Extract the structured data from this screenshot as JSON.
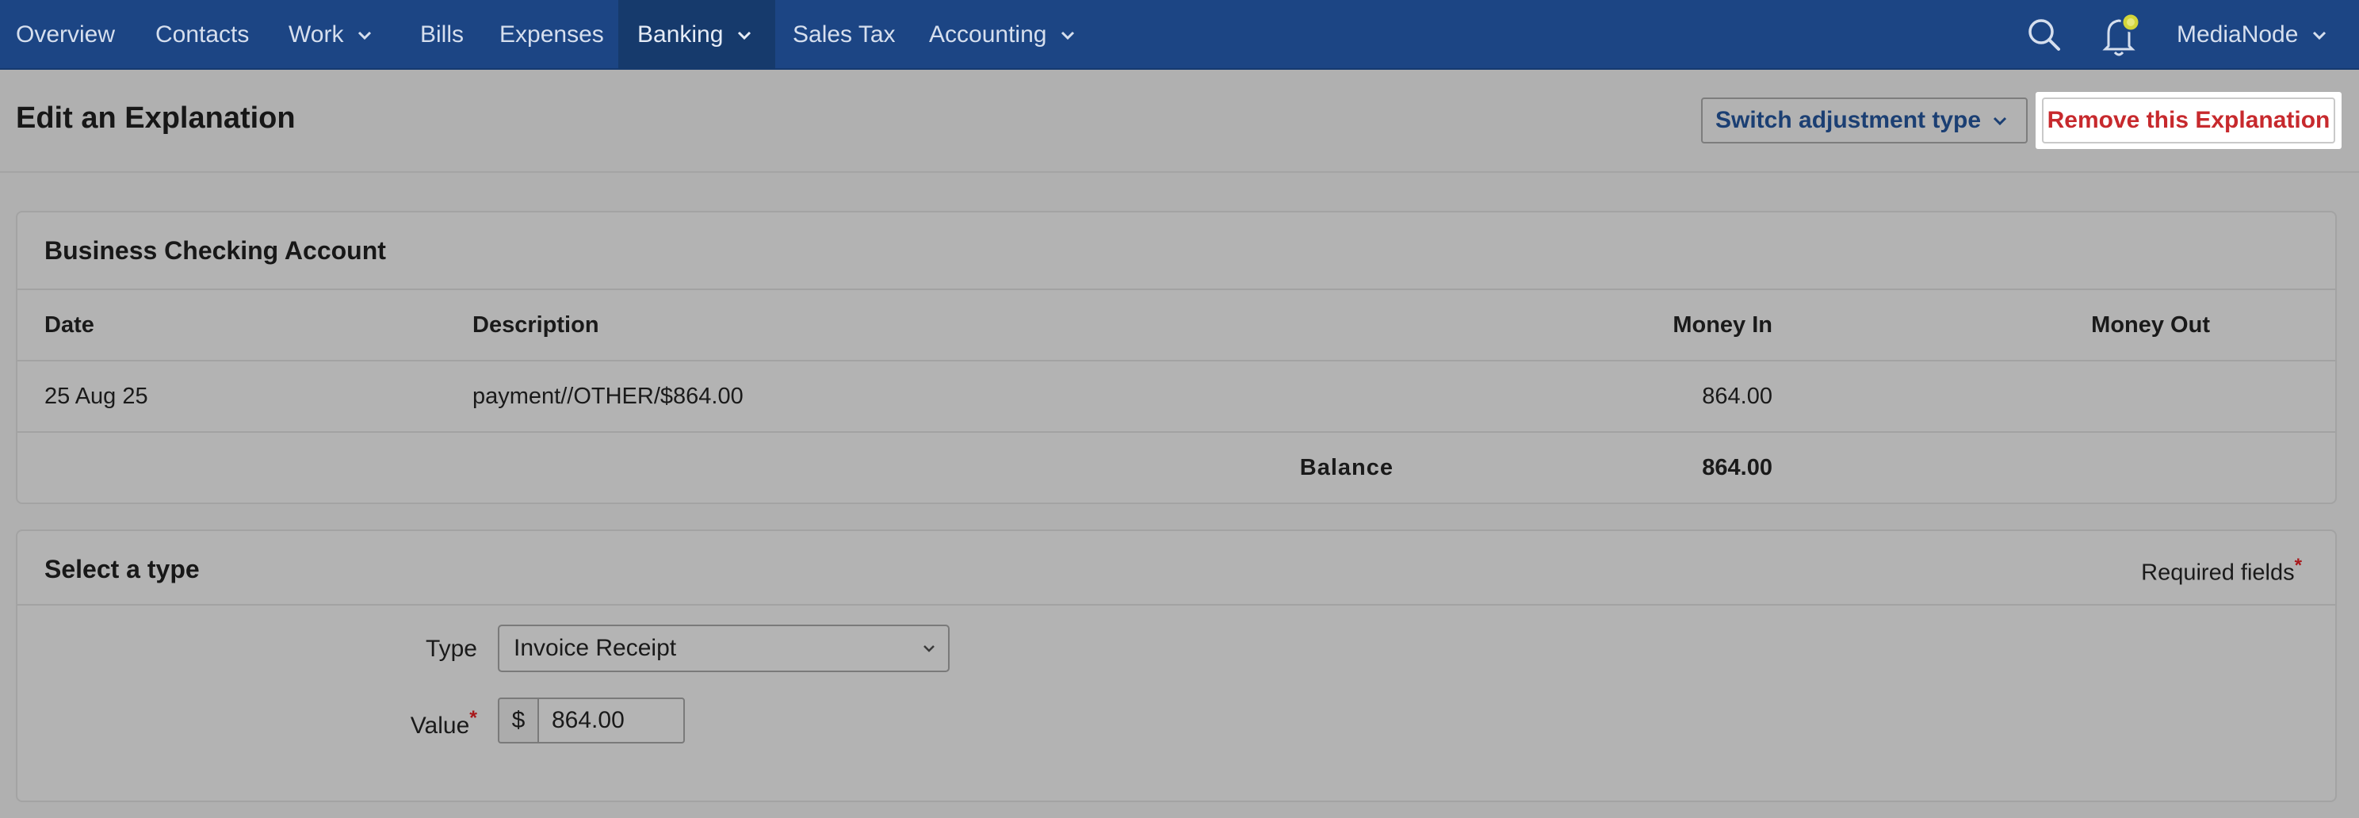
{
  "nav": {
    "items": [
      {
        "label": "Overview",
        "has_dropdown": false,
        "active": false
      },
      {
        "label": "Contacts",
        "has_dropdown": false,
        "active": false
      },
      {
        "label": "Work",
        "has_dropdown": true,
        "active": false
      },
      {
        "label": "Bills",
        "has_dropdown": false,
        "active": false
      },
      {
        "label": "Expenses",
        "has_dropdown": false,
        "active": false
      },
      {
        "label": "Banking",
        "has_dropdown": true,
        "active": true
      },
      {
        "label": "Sales Tax",
        "has_dropdown": false,
        "active": false
      },
      {
        "label": "Accounting",
        "has_dropdown": true,
        "active": false
      }
    ],
    "search_icon": "search-icon",
    "notifications_icon": "bell-icon",
    "user_label": "MediaNode"
  },
  "header": {
    "title": "Edit an Explanation",
    "switch_label": "Switch adjustment type",
    "remove_label": "Remove this Explanation"
  },
  "account": {
    "title": "Business Checking Account",
    "columns": {
      "date": "Date",
      "description": "Description",
      "money_in": "Money In",
      "money_out": "Money Out"
    },
    "rows": [
      {
        "date": "25 Aug 25",
        "description": "payment//OTHER/$864.00",
        "money_in": "864.00",
        "money_out": ""
      }
    ],
    "balance_label": "Balance",
    "balance_value": "864.00"
  },
  "type_section": {
    "title": "Select a type",
    "required_note": "Required fields",
    "required_star": "*",
    "type_label": "Type",
    "type_value": "Invoice Receipt",
    "value_label": "Value",
    "value_star": "*",
    "currency_symbol": "$",
    "value_amount": "864.00"
  },
  "colors": {
    "nav_bg": "#1c4584",
    "nav_active_bg": "#163a6c",
    "remove_text": "#c7292d",
    "switch_text": "#1b3f73",
    "required_star": "#a8181b"
  }
}
